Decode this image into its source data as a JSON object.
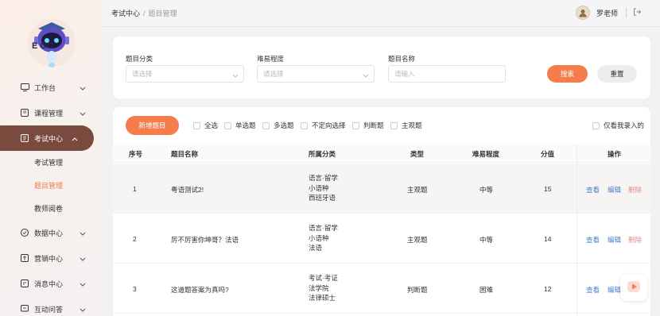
{
  "logo": {
    "text": "E  OC"
  },
  "sidebar": {
    "items": [
      {
        "label": "工作台",
        "icon": "monitor-icon"
      },
      {
        "label": "课程管理",
        "icon": "book-icon"
      },
      {
        "label": "考试中心",
        "icon": "document-icon",
        "active": true
      },
      {
        "label": "数据中心",
        "icon": "chart-circle-icon"
      },
      {
        "label": "营销中心",
        "icon": "megaphone-icon"
      },
      {
        "label": "消息中心",
        "icon": "message-icon"
      },
      {
        "label": "互动问答",
        "icon": "chat-icon"
      }
    ],
    "sub_items": [
      {
        "label": "考试管理"
      },
      {
        "label": "题目管理",
        "active": true
      },
      {
        "label": "教师阅卷"
      }
    ]
  },
  "header": {
    "breadcrumb_parent": "考试中心",
    "breadcrumb_sep": "/",
    "breadcrumb_current": "题目管理",
    "user_name": "罗老师"
  },
  "filter": {
    "category_label": "题目分类",
    "category_placeholder": "请选择",
    "difficulty_label": "难易程度",
    "difficulty_placeholder": "请选择",
    "name_label": "题目名称",
    "name_placeholder": "请输入",
    "search_label": "搜索",
    "reset_label": "重置"
  },
  "toolbar": {
    "new_label": "新增题目",
    "types": [
      "全选",
      "单选题",
      "多选题",
      "不定向选择",
      "判断题",
      "主观题"
    ],
    "mine_only": "仅看我录入的"
  },
  "table": {
    "headers": [
      "序号",
      "题目名称",
      "所属分类",
      "类型",
      "难易程度",
      "分值",
      "操作"
    ],
    "rows": [
      {
        "no": "1",
        "name": "粤语测试2!",
        "cats": [
          "语言·留学",
          "小语种",
          "西班牙语"
        ],
        "type": "主观题",
        "difficulty": "中等",
        "score": "15"
      },
      {
        "no": "2",
        "name": "厉不厉害你坤哥？法语",
        "cats": [
          "语言·留学",
          "小语种",
          "法语"
        ],
        "type": "主观题",
        "difficulty": "中等",
        "score": "14"
      },
      {
        "no": "3",
        "name": "这道题答案为真吗?",
        "cats": [
          "考试·考证",
          "法学院",
          "法律硕士"
        ],
        "type": "判断题",
        "difficulty": "困难",
        "score": "12"
      }
    ],
    "actions": {
      "view": "查看",
      "edit": "编辑",
      "delete": "删除"
    }
  },
  "colors": {
    "accent": "#f57d4b",
    "active_nav": "#7a4a3e",
    "link": "#4a7fc9",
    "danger": "#e98a8a"
  }
}
